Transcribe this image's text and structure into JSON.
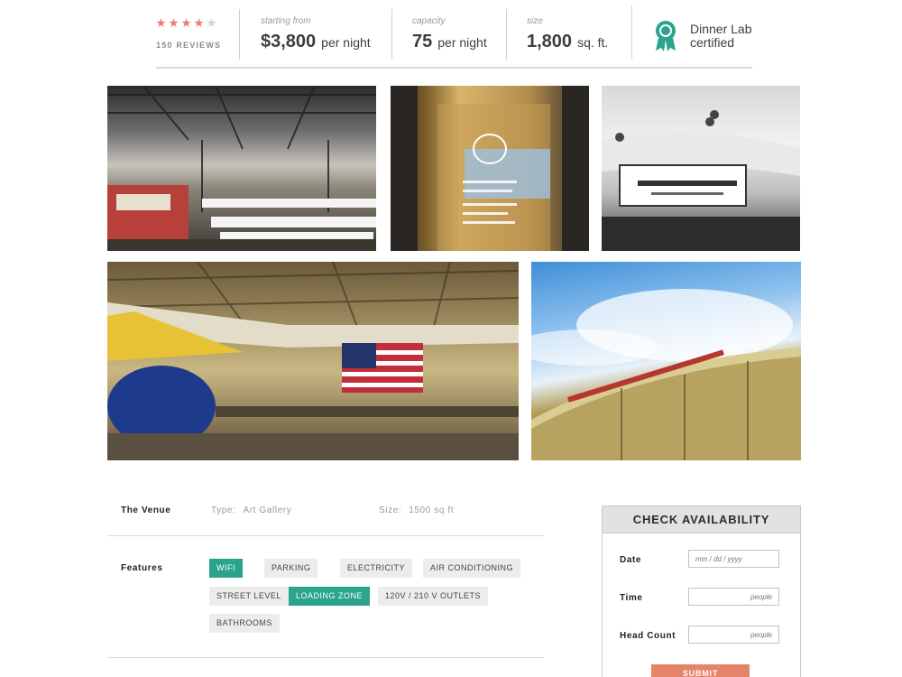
{
  "rating": {
    "stars": 4,
    "max": 5,
    "reviews_label": "150 REVIEWS"
  },
  "stats": [
    {
      "label": "starting from",
      "value": "$3,800",
      "unit": "per night"
    },
    {
      "label": "capacity",
      "value": "75",
      "unit": "per night"
    },
    {
      "label": "size",
      "value": "1,800",
      "unit": "sq. ft."
    }
  ],
  "certification": {
    "line1": "Dinner Lab",
    "line2": "certified",
    "icon": "award-ribbon-icon",
    "color": "#2aa48d"
  },
  "photos": [
    {
      "name": "hangar-dinner-setup-photo"
    },
    {
      "name": "museum-entrance-door-photo"
    },
    {
      "name": "airline-history-museum-sign-photo"
    },
    {
      "name": "hangar-aircraft-flag-photo"
    },
    {
      "name": "museum-exterior-photo"
    }
  ],
  "venue": {
    "title": "The Venue",
    "type_label": "Type:",
    "type_value": "Art Gallery",
    "size_label": "Size:",
    "size_value": "1500 sq ft"
  },
  "features": {
    "title": "Features",
    "tags": [
      {
        "label": "WIFI",
        "active": true
      },
      {
        "label": "PARKING",
        "active": false
      },
      {
        "label": "ELECTRICITY",
        "active": false
      },
      {
        "label": "AIR CONDITIONING",
        "active": false
      },
      {
        "label": "STREET LEVEL",
        "active": false
      },
      {
        "label": "LOADING ZONE",
        "active": true
      },
      {
        "label": "120V / 210 V OUTLETS",
        "active": false
      },
      {
        "label": "BATHROOMS",
        "active": false
      }
    ]
  },
  "availability": {
    "title": "CHECK AVAILABILITY",
    "date_label": "Date",
    "date_placeholder": "mm / dd / yyyy",
    "time_label": "Time",
    "time_placeholder": "people",
    "headcount_label": "Head Count",
    "headcount_placeholder": "people",
    "submit_label": "SUBMIT"
  },
  "colors": {
    "accent": "#2aa48d",
    "star": "#e5826a",
    "submit": "#e58468"
  }
}
